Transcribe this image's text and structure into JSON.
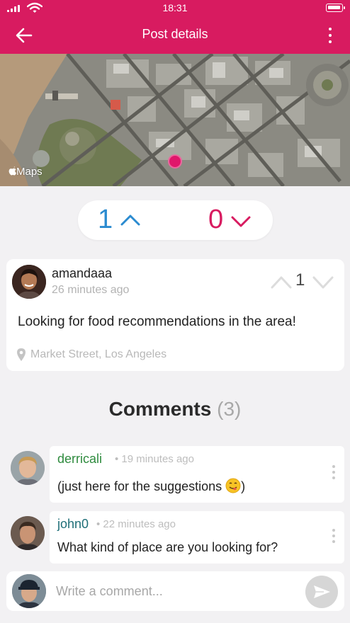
{
  "status_bar": {
    "time": "18:31"
  },
  "header": {
    "title": "Post details",
    "back_icon": "arrow-left-icon",
    "more_icon": "vertical-dots-icon",
    "background": "#d81b60"
  },
  "map": {
    "attribution": "Maps",
    "logo_icon": "apple-logo-icon",
    "pin_color": "#e0176b"
  },
  "vote_summary": {
    "upvotes": "1",
    "downvotes": "0",
    "up_color": "#2b8bd0",
    "down_color": "#d81b60"
  },
  "post": {
    "username": "amandaaa",
    "time": "26 minutes ago",
    "score": "1",
    "text": "Looking for food recommendations in the area!",
    "location": "Market Street, Los Angeles"
  },
  "comments_section": {
    "heading": "Comments",
    "count": "(3)"
  },
  "comments": [
    {
      "username": "derricali",
      "meta": "• 19 minutes ago",
      "text": "(just here for the suggestions ",
      "emoji": "yum-face-emoji",
      "text_end": ")"
    },
    {
      "username": "john0",
      "meta": "• 22 minutes ago",
      "text": "What kind of place are you looking for?"
    }
  ],
  "compose": {
    "placeholder": "Write a comment...",
    "send_icon": "paper-plane-icon"
  }
}
